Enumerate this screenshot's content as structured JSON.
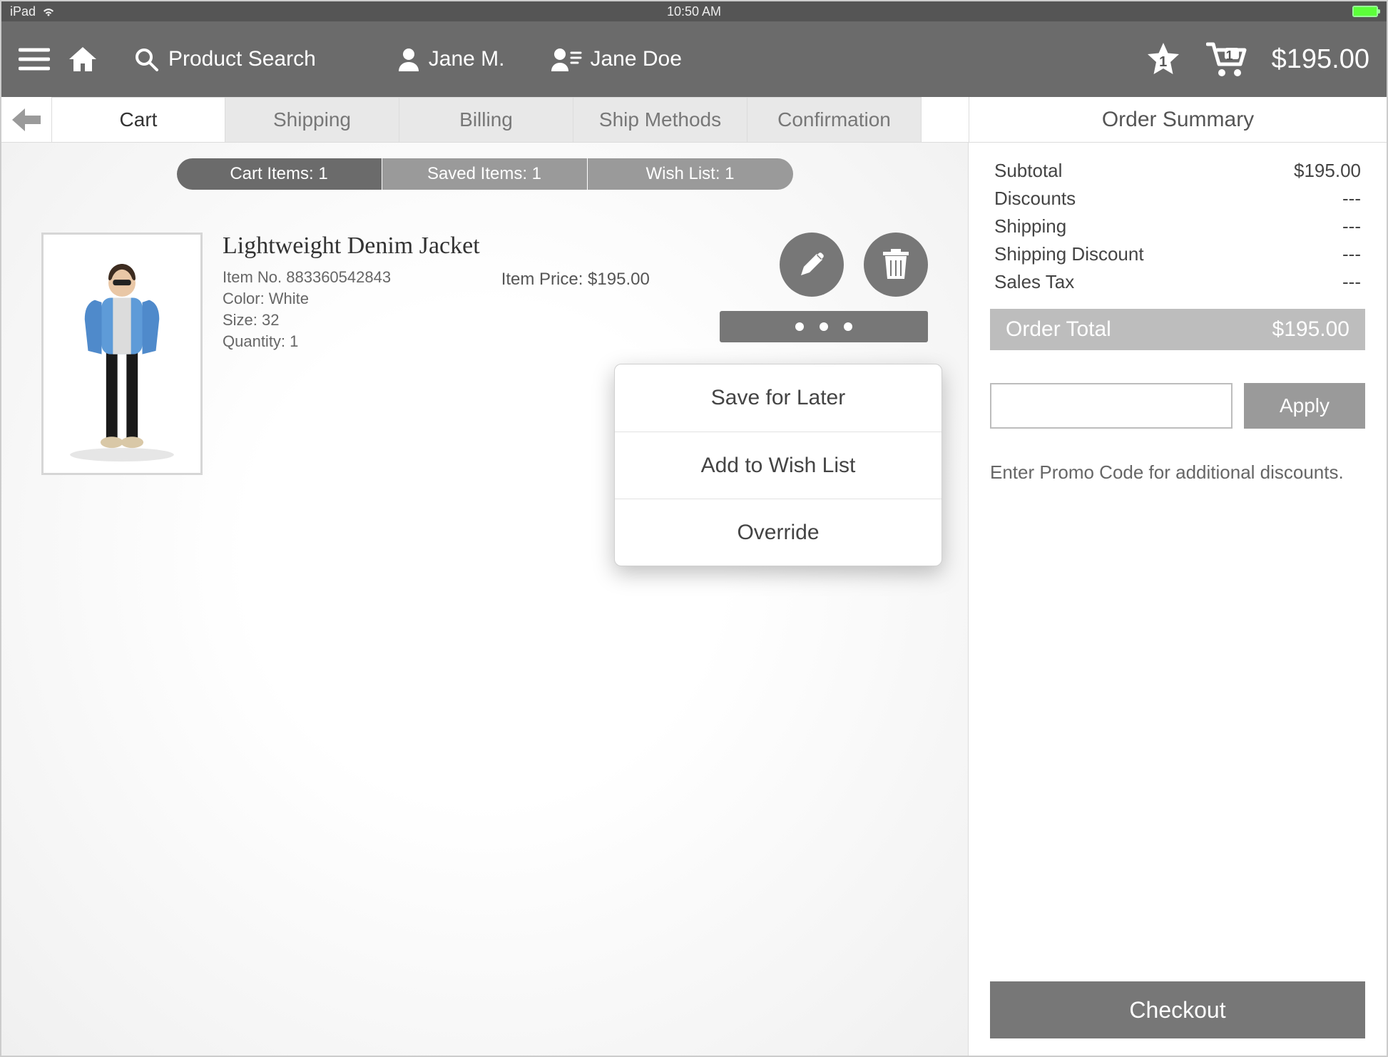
{
  "status": {
    "device": "iPad",
    "time": "10:50 AM"
  },
  "toolbar": {
    "search_placeholder": "Product Search",
    "associate": "Jane M.",
    "customer": "Jane Doe",
    "star_badge": "1",
    "cart_badge": "1",
    "amount": "$195.00"
  },
  "phases": {
    "tabs": [
      {
        "label": "Cart",
        "active": true
      },
      {
        "label": "Shipping",
        "active": false
      },
      {
        "label": "Billing",
        "active": false
      },
      {
        "label": "Ship Methods",
        "active": false
      },
      {
        "label": "Confirmation",
        "active": false
      }
    ],
    "summary_label": "Order Summary"
  },
  "pills": {
    "cart_items": "Cart Items: 1",
    "saved_items": "Saved Items: 1",
    "wish_list": "Wish List: 1"
  },
  "item": {
    "title": "Lightweight Denim Jacket",
    "item_no": "Item No. 883360542843",
    "color": "Color: White",
    "size": "Size: 32",
    "qty": "Quantity: 1",
    "price": "Item Price: $195.00"
  },
  "dropdown": {
    "items": [
      "Save for Later",
      "Add to Wish List",
      "Override"
    ]
  },
  "summary": {
    "rows": [
      {
        "label": "Subtotal",
        "value": "$195.00"
      },
      {
        "label": "Discounts",
        "value": "---"
      },
      {
        "label": "Shipping",
        "value": "---"
      },
      {
        "label": "Shipping Discount",
        "value": "---"
      },
      {
        "label": "Sales Tax",
        "value": "---"
      }
    ],
    "total_label": "Order Total",
    "total_value": "$195.00",
    "apply_label": "Apply",
    "promo_hint": "Enter Promo Code for additional discounts.",
    "checkout_label": "Checkout"
  }
}
